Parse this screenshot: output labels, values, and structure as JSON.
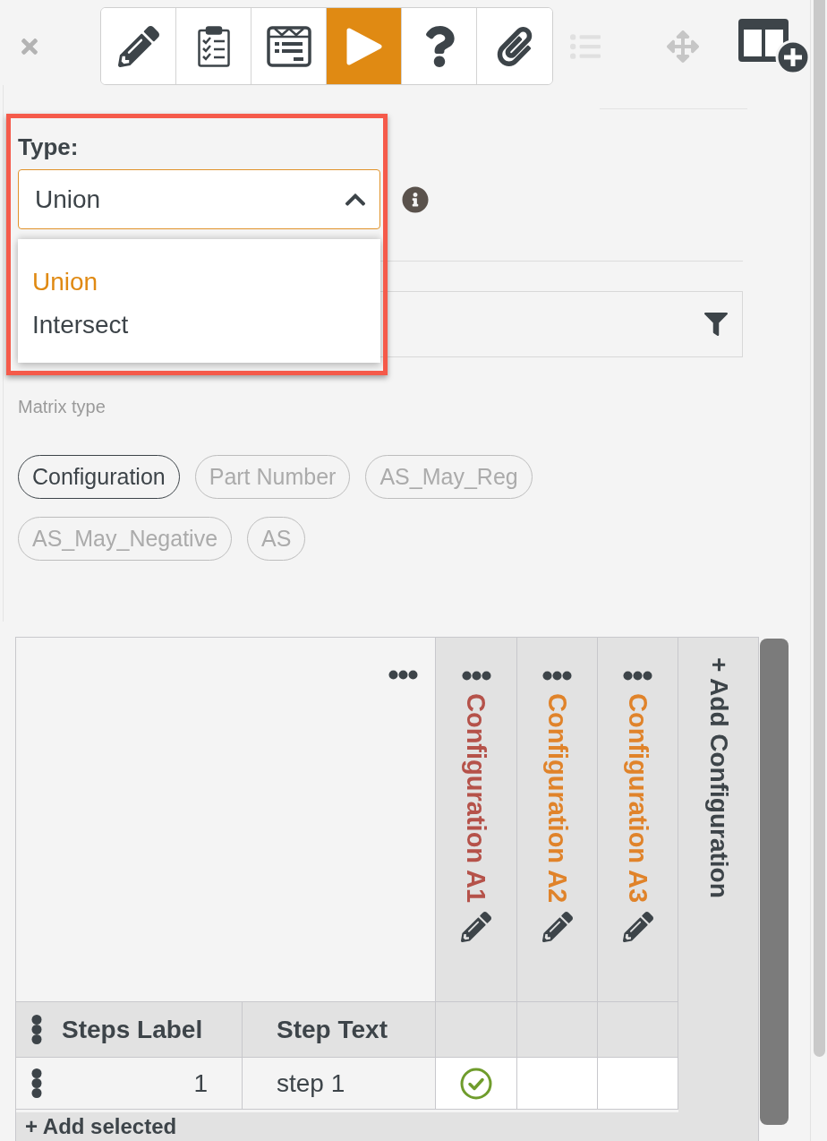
{
  "toolbar": {
    "tools": [
      {
        "selected": false
      },
      {
        "selected": false
      },
      {
        "selected": false
      },
      {
        "selected": true
      },
      {
        "selected": false
      },
      {
        "selected": false
      }
    ],
    "list_button": {
      "disabled": true
    }
  },
  "type_field": {
    "label": "Type:",
    "value": "Union",
    "expanded": true,
    "options": [
      {
        "label": "Union",
        "selected": true
      },
      {
        "label": "Intersect",
        "selected": false
      }
    ]
  },
  "matrix_type": {
    "label": "Matrix type",
    "chips": [
      {
        "label": "Configuration",
        "selected": true
      },
      {
        "label": "Part Number",
        "selected": false
      },
      {
        "label": "AS_May_Reg",
        "selected": false
      },
      {
        "label": "AS_May_Negative",
        "selected": false
      },
      {
        "label": "AS",
        "selected": false
      }
    ]
  },
  "matrix": {
    "columns": [
      {
        "label": "Configuration A1",
        "color": "#b5524a"
      },
      {
        "label": "Configuration A2",
        "color": "#e0832a"
      },
      {
        "label": "Configuration A3",
        "color": "#e0832a"
      }
    ],
    "add_column": "+ Add Configuration",
    "header": {
      "steps_label": "Steps Label",
      "step_text": "Step Text"
    },
    "rows": [
      {
        "label": "1",
        "text": "step 1",
        "cells": [
          {
            "checked": true
          },
          {
            "checked": false
          },
          {
            "checked": false
          }
        ]
      }
    ],
    "add_row": "+ Add selected"
  }
}
